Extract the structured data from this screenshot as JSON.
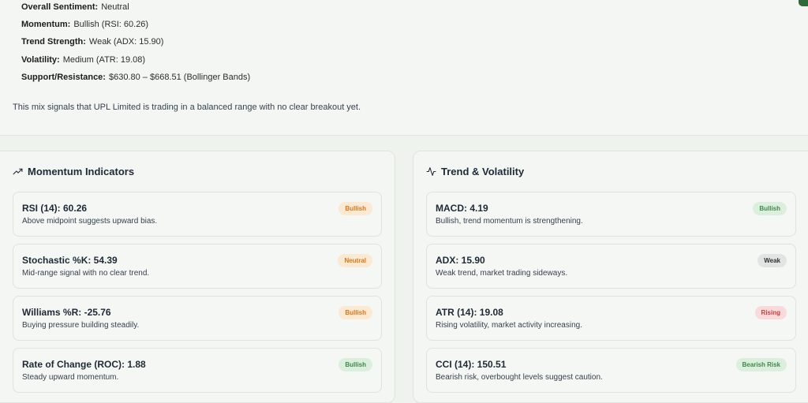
{
  "summary": {
    "overall_label": "Overall Sentiment:",
    "overall_value": "Neutral",
    "momentum_label": "Momentum:",
    "momentum_value": "Bullish (RSI: 60.26)",
    "trend_label": "Trend Strength:",
    "trend_value": "Weak (ADX: 15.90)",
    "volatility_label": "Volatility:",
    "volatility_value": "Medium (ATR: 19.08)",
    "sr_label": "Support/Resistance:",
    "sr_value": "$630.80 – $668.51 (Bollinger Bands)",
    "conclusion": "This mix signals that UPL Limited is trading in a balanced range with no clear breakout yet."
  },
  "momentum_panel": {
    "title": "Momentum Indicators",
    "icon": "trending-up-icon",
    "cards": [
      {
        "name": "RSI (14): 60.26",
        "desc": "Above midpoint suggests upward bias.",
        "badge": "Bullish",
        "badge_color": "#d9761c"
      },
      {
        "name": "Stochastic %K: 54.39",
        "desc": "Mid-range signal with no clear trend.",
        "badge": "Neutral",
        "badge_color": "#d9761c"
      },
      {
        "name": "Williams %R: -25.76",
        "desc": "Buying pressure building steadily.",
        "badge": "Bullish",
        "badge_color": "#d9761c"
      },
      {
        "name": "Rate of Change (ROC): 1.88",
        "desc": "Steady upward momentum.",
        "badge": "Bullish",
        "badge_color": "#3b8a4a"
      }
    ]
  },
  "trend_panel": {
    "title": "Trend & Volatility",
    "icon": "activity-icon",
    "cards": [
      {
        "name": "MACD: 4.19",
        "desc": "Bullish, trend momentum is strengthening.",
        "badge": "Bullish",
        "badge_color": "#3b8a4a"
      },
      {
        "name": "ADX: 15.90",
        "desc": "Weak trend, market trading sideways.",
        "badge": "Weak",
        "badge_color": "#2d3330"
      },
      {
        "name": "ATR (14): 19.08",
        "desc": "Rising volatility, market activity increasing.",
        "badge": "Rising",
        "badge_color": "#d33b3b"
      },
      {
        "name": "CCI (14): 150.51",
        "desc": "Bearish risk, overbought levels suggest caution.",
        "badge": "Bearish Risk",
        "badge_color": "#3b8a4a"
      }
    ]
  }
}
